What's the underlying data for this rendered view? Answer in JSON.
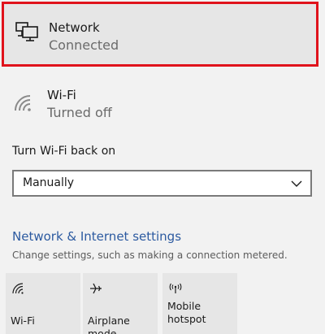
{
  "network": {
    "title": "Network",
    "status": "Connected",
    "icon": "ethernet-monitor-icon",
    "highlight_color": "#e0131c"
  },
  "wifi": {
    "title": "Wi-Fi",
    "status": "Turned off",
    "icon": "wifi-off-icon"
  },
  "wifi_back_on": {
    "label": "Turn Wi-Fi back on",
    "selected": "Manually"
  },
  "settings": {
    "link": "Network & Internet settings",
    "description": "Change settings, such as making a connection metered.",
    "link_color": "#2c5aa0"
  },
  "quick_actions": [
    {
      "label": "Wi-Fi",
      "icon": "wifi-icon"
    },
    {
      "label": "Airplane mode",
      "icon": "airplane-icon"
    },
    {
      "label": "Mobile\nhotspot",
      "icon": "hotspot-icon"
    }
  ]
}
